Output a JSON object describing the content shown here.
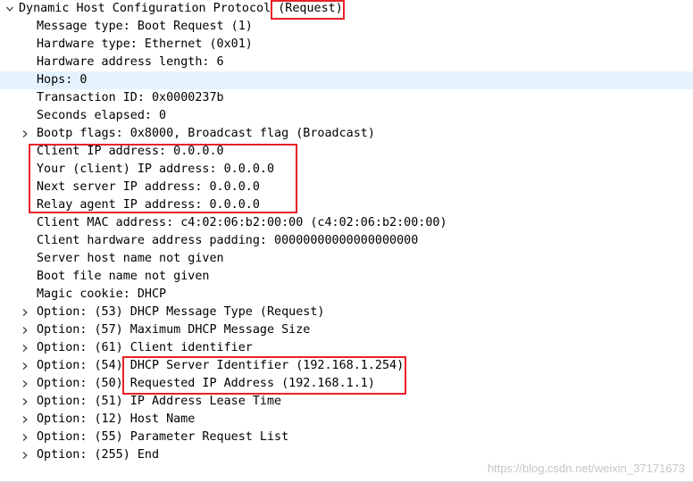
{
  "packet_tree": {
    "root": {
      "label": "Dynamic Host Configuration Protocol (Request)",
      "expanded": true
    },
    "fields": [
      {
        "label": "Message type: Boot Request (1)",
        "expandable": false
      },
      {
        "label": "Hardware type: Ethernet (0x01)",
        "expandable": false
      },
      {
        "label": "Hardware address length: 6",
        "expandable": false
      },
      {
        "label": "Hops: 0",
        "expandable": false,
        "selected": true
      },
      {
        "label": "Transaction ID: 0x0000237b",
        "expandable": false
      },
      {
        "label": "Seconds elapsed: 0",
        "expandable": false
      },
      {
        "label": "Bootp flags: 0x8000, Broadcast flag (Broadcast)",
        "expandable": true
      },
      {
        "label": "Client IP address: 0.0.0.0",
        "expandable": false
      },
      {
        "label": "Your (client) IP address: 0.0.0.0",
        "expandable": false
      },
      {
        "label": "Next server IP address: 0.0.0.0",
        "expandable": false
      },
      {
        "label": "Relay agent IP address: 0.0.0.0",
        "expandable": false
      },
      {
        "label": "Client MAC address: c4:02:06:b2:00:00 (c4:02:06:b2:00:00)",
        "expandable": false
      },
      {
        "label": "Client hardware address padding: 00000000000000000000",
        "expandable": false
      },
      {
        "label": "Server host name not given",
        "expandable": false
      },
      {
        "label": "Boot file name not given",
        "expandable": false
      },
      {
        "label": "Magic cookie: DHCP",
        "expandable": false
      },
      {
        "label": "Option: (53) DHCP Message Type (Request)",
        "expandable": true
      },
      {
        "label": "Option: (57) Maximum DHCP Message Size",
        "expandable": true
      },
      {
        "label": "Option: (61) Client identifier",
        "expandable": true
      },
      {
        "label": "Option: (54) DHCP Server Identifier (192.168.1.254)",
        "expandable": true
      },
      {
        "label": "Option: (50) Requested IP Address (192.168.1.1)",
        "expandable": true
      },
      {
        "label": "Option: (51) IP Address Lease Time",
        "expandable": true
      },
      {
        "label": "Option: (12) Host Name",
        "expandable": true
      },
      {
        "label": "Option: (55) Parameter Request List",
        "expandable": true
      },
      {
        "label": "Option: (255) End",
        "expandable": true
      }
    ]
  },
  "annotation_color": "#e8202a",
  "selection_color": "#e5f3ff",
  "watermark": "https://blog.csdn.net/weixin_37171673"
}
